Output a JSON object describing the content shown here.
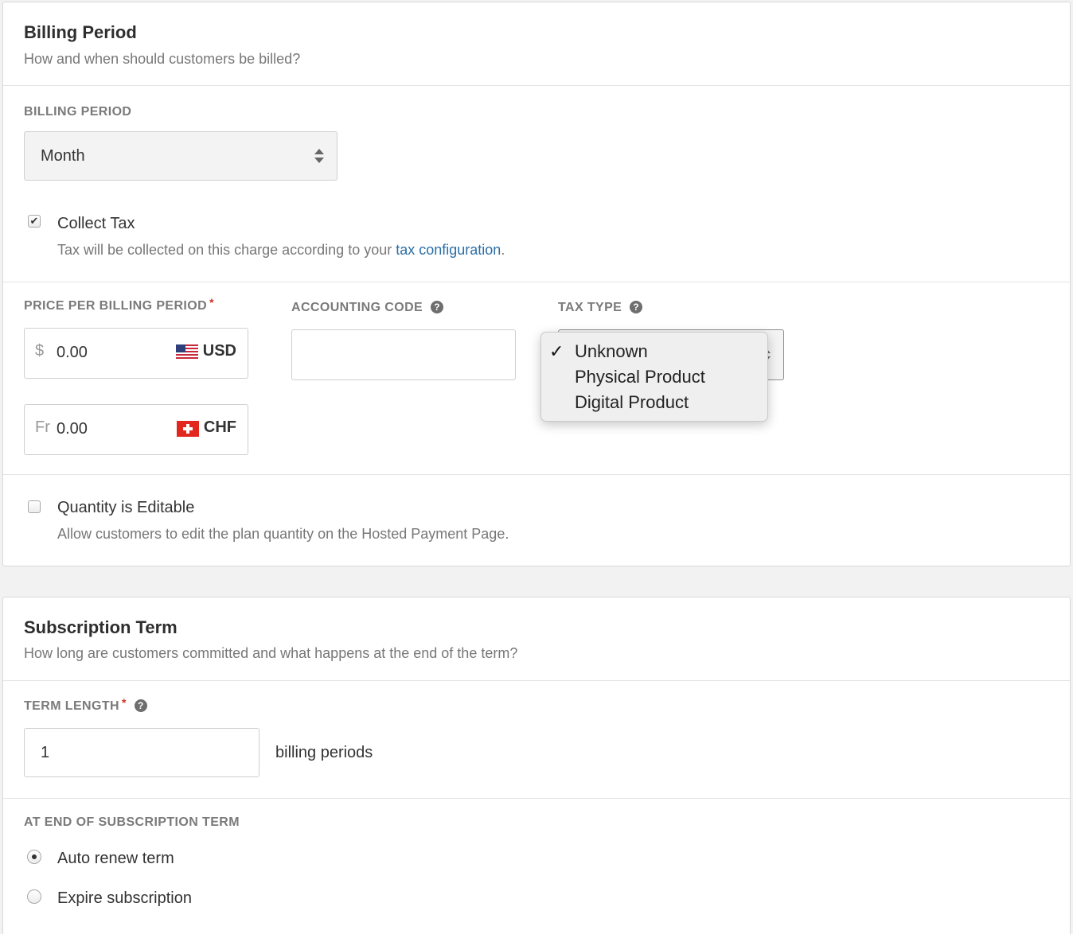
{
  "billing": {
    "title": "Billing Period",
    "subtitle": "How and when should customers be billed?",
    "period_label": "BILLING PERIOD",
    "period_value": "Month",
    "collect_tax": {
      "label": "Collect Tax",
      "checked": true,
      "help_prefix": "Tax will be collected on this charge according to your ",
      "help_link": "tax configuration",
      "help_suffix": "."
    },
    "price_label": "PRICE PER BILLING PERIOD",
    "required_mark": "*",
    "prices": [
      {
        "symbol": "$",
        "value": "0.00",
        "currency": "USD",
        "flag": "us-flag-icon"
      },
      {
        "symbol": "Fr",
        "value": "0.00",
        "currency": "CHF",
        "flag": "swiss-flag-icon"
      }
    ],
    "accounting_label": "ACCOUNTING CODE",
    "accounting_value": "",
    "tax_type_label": "TAX TYPE",
    "tax_type_options": [
      "Unknown",
      "Physical Product",
      "Digital Product"
    ],
    "tax_type_selected": "Unknown",
    "quantity": {
      "label": "Quantity is Editable",
      "checked": false,
      "help": "Allow customers to edit the plan quantity on the Hosted Payment Page."
    }
  },
  "term": {
    "title": "Subscription Term",
    "subtitle": "How long are customers committed and what happens at the end of the term?",
    "length_label": "TERM LENGTH",
    "required_mark": "*",
    "length_value": "1",
    "length_unit": "billing periods",
    "end_label": "AT END OF SUBSCRIPTION TERM",
    "end_options": [
      {
        "label": "Auto renew term",
        "selected": true
      },
      {
        "label": "Expire subscription",
        "selected": false
      }
    ]
  },
  "colors": {
    "link": "#2a6ea6",
    "required": "#d0342c",
    "label_gray": "#7a7a7a"
  }
}
